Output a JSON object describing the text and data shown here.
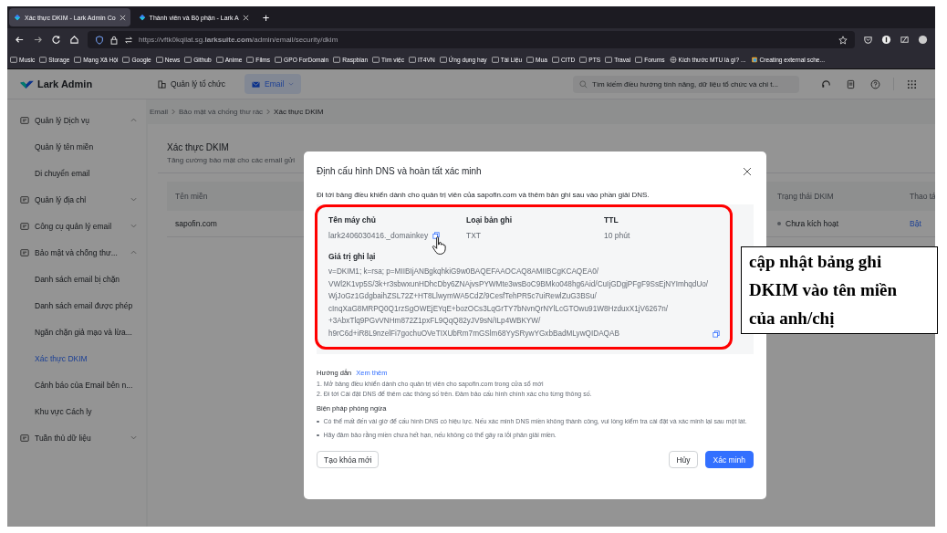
{
  "browser": {
    "tabs": [
      {
        "title": "Xác thực DKIM - Lark Admin Co",
        "selected": true
      },
      {
        "title": "Thành viên và Bộ phận - Lark A",
        "selected": false
      }
    ],
    "new_tab": "+",
    "url": "https://vftk0kqilat.sg.**larksuite.com**/admin/email/security/dkim",
    "bookmarks": [
      {
        "label": "Music",
        "kind": "folder"
      },
      {
        "label": "Storage",
        "kind": "folder"
      },
      {
        "label": "Mạng Xã Hội",
        "kind": "folder"
      },
      {
        "label": "Google",
        "kind": "folder"
      },
      {
        "label": "News",
        "kind": "folder"
      },
      {
        "label": "Github",
        "kind": "folder"
      },
      {
        "label": "Anime",
        "kind": "folder"
      },
      {
        "label": "Films",
        "kind": "folder"
      },
      {
        "label": "GPO ForDomain",
        "kind": "folder"
      },
      {
        "label": "Raspbian",
        "kind": "folder"
      },
      {
        "label": "Tìm việc",
        "kind": "folder"
      },
      {
        "label": "IT4VN",
        "kind": "folder"
      },
      {
        "label": "Ứng dụng hay",
        "kind": "folder"
      },
      {
        "label": "Tài Liệu",
        "kind": "folder"
      },
      {
        "label": "Mua",
        "kind": "folder"
      },
      {
        "label": "CITD",
        "kind": "folder"
      },
      {
        "label": "PTS",
        "kind": "folder"
      },
      {
        "label": "Traval",
        "kind": "folder"
      },
      {
        "label": "Forums",
        "kind": "folder"
      },
      {
        "label": "Kích thước MTU là gì? ...",
        "kind": "globe"
      },
      {
        "label": "Creating external sche...",
        "kind": "app"
      }
    ]
  },
  "header": {
    "logo": "Lark Admin",
    "nav": [
      {
        "label": "Quản lý tổ chức",
        "selected": false
      },
      {
        "label": "Email",
        "selected": true
      }
    ],
    "search": {
      "placeholder": "Tìm kiếm điều hướng tính năng, dữ liệu tổ chức và chi t..."
    }
  },
  "sidebar": {
    "items": [
      {
        "label": "Quản lý Dịch vụ",
        "expanded": true,
        "children": [
          {
            "label": "Quản lý tên miền",
            "selected": false
          },
          {
            "label": "Di chuyển email",
            "selected": false
          }
        ]
      },
      {
        "label": "Quản lý địa chỉ",
        "expanded": false
      },
      {
        "label": "Công cụ quản lý email",
        "expanded": false
      },
      {
        "label": "Bảo mật và chống thư...",
        "expanded": true,
        "children": [
          {
            "label": "Danh sách email bị chặn",
            "selected": false
          },
          {
            "label": "Danh sách email được phép",
            "selected": false
          },
          {
            "label": "Ngăn chặn giả mạo và lừa...",
            "selected": false
          },
          {
            "label": "Xác thực DKIM",
            "selected": true
          },
          {
            "label": "Cảnh báo của Email bên n...",
            "selected": false
          },
          {
            "label": "Khu vực Cách ly",
            "selected": false
          }
        ]
      },
      {
        "label": "Tuần thủ dữ liệu",
        "expanded": false
      }
    ]
  },
  "breadcrumb": [
    "Email",
    "Bảo mật và chống thư rác",
    "Xác thực DKIM"
  ],
  "page": {
    "title": "Xác thực DKIM",
    "subtitle": "Tăng cường bảo mật cho các email gửi"
  },
  "table": {
    "columns": [
      "Tên miền",
      "Trạng thái DKIM",
      "Thao tá"
    ],
    "rows": [
      {
        "domain": "sapofin.com",
        "status": "Chưa kích hoạt",
        "action": "Bật"
      }
    ]
  },
  "dialog": {
    "title": "Định cấu hình DNS và hoàn tất xác minh",
    "description": "Đi tới bảng điều khiển dành cho quản trị viên của sapofin.com và thêm bản ghi sau vào phần giải DNS.",
    "fields": [
      {
        "label": "Tên máy chủ",
        "value": "lark2406030416._domainkey",
        "copyable": true
      },
      {
        "label": "Loại bản ghi",
        "value": "TXT",
        "copyable": false
      },
      {
        "label": "TTL",
        "value": "10 phút",
        "copyable": false
      }
    ],
    "record_value": {
      "label": "Giá trị ghi lại",
      "value": "v=DKIM1; k=rsa; p=MIIBIjANBgkqhkiG9w0BAQEFAAOCAQ8AMIIBCgKCAQEA0/\nVWl2K1vp5S/3k+r3sbwxunHDhcDby6ZNAjvsPYWMte3wsBoC9BMko048hg6Aid/CuIjGDgjPFgF9SsEjNYImhqdUo/\nWjJoGz1GdgbaihZSL72Z+HT8LlwymWA5CdZ/9CesfTehPR5c7uiRewlZuG3BSu/\ncInqXaG8MRPQ0Q1rzSgOWEjEYqE+bozOCs3LqGrTY7bNvnQrNYlLcGTOwu91W8HzduxX1jV6267n/\n+3AbxTlq9PGvVNHm872Z1pxFL9QqQ82yJV9sN/ILp4WBKYW/\nh9rC6d+iR8L9nzelFi7gochuOVeTIXUbRm7mGSlm68YySRywYGxbBadMLywQIDAQAB"
    },
    "guide": {
      "title": "Hướng dẫn",
      "link": "Xem thêm",
      "steps": [
        "1. Mở bảng điều khiển dành cho quản trị viên cho sapofin.com trong cửa sổ mới",
        "2. Đi tới Cài đặt DNS để thêm các thông số trên. Đảm bảo cấu hình chính xác cho từng thông số."
      ]
    },
    "precautions": {
      "title": "Biện pháp phòng ngừa",
      "items": [
        "Có thể mất đến vài giờ để cấu hình DNS có hiệu lực. Nếu xác minh DNS miền không thành công, vui lòng kiểm tra cài đặt và xác minh lại sau một lát.",
        "Hãy đảm bảo rằng miền chưa hết hạn, nếu không có thể gây ra lỗi phân giải miền."
      ]
    },
    "left_button": {
      "label": "Tạo khóa mới"
    },
    "buttons": [
      {
        "label": "Hủy",
        "kind": "default"
      },
      {
        "label": "Xác minh",
        "kind": "primary"
      }
    ]
  },
  "callout": "cập nhật bảng ghi DKIM vào tên miền của anh/chị"
}
